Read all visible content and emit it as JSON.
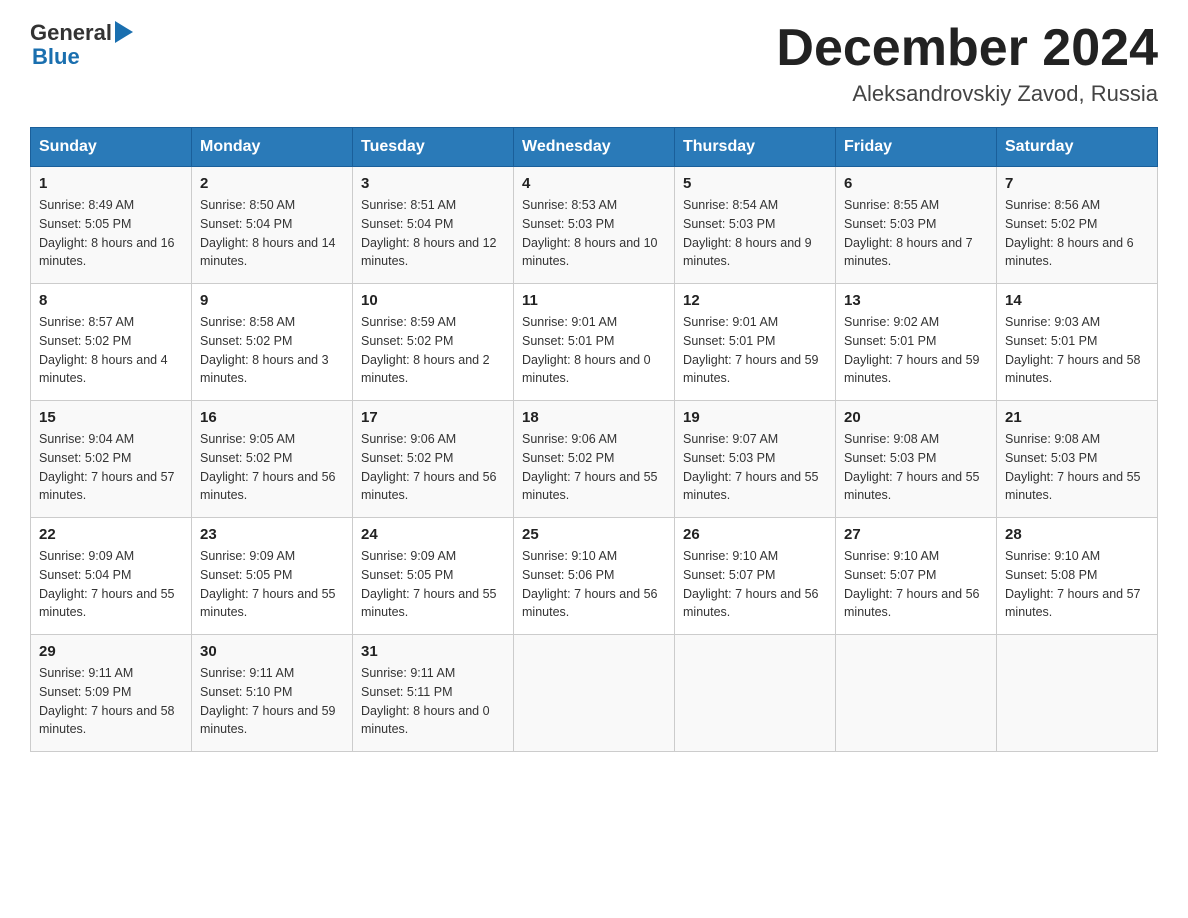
{
  "header": {
    "logo_general": "General",
    "logo_triangle": "▶",
    "logo_blue": "Blue",
    "month_title": "December 2024",
    "location": "Aleksandrovskiy Zavod, Russia"
  },
  "days_of_week": [
    "Sunday",
    "Monday",
    "Tuesday",
    "Wednesday",
    "Thursday",
    "Friday",
    "Saturday"
  ],
  "weeks": [
    [
      {
        "day": "1",
        "sunrise": "8:49 AM",
        "sunset": "5:05 PM",
        "daylight": "8 hours and 16 minutes."
      },
      {
        "day": "2",
        "sunrise": "8:50 AM",
        "sunset": "5:04 PM",
        "daylight": "8 hours and 14 minutes."
      },
      {
        "day": "3",
        "sunrise": "8:51 AM",
        "sunset": "5:04 PM",
        "daylight": "8 hours and 12 minutes."
      },
      {
        "day": "4",
        "sunrise": "8:53 AM",
        "sunset": "5:03 PM",
        "daylight": "8 hours and 10 minutes."
      },
      {
        "day": "5",
        "sunrise": "8:54 AM",
        "sunset": "5:03 PM",
        "daylight": "8 hours and 9 minutes."
      },
      {
        "day": "6",
        "sunrise": "8:55 AM",
        "sunset": "5:03 PM",
        "daylight": "8 hours and 7 minutes."
      },
      {
        "day": "7",
        "sunrise": "8:56 AM",
        "sunset": "5:02 PM",
        "daylight": "8 hours and 6 minutes."
      }
    ],
    [
      {
        "day": "8",
        "sunrise": "8:57 AM",
        "sunset": "5:02 PM",
        "daylight": "8 hours and 4 minutes."
      },
      {
        "day": "9",
        "sunrise": "8:58 AM",
        "sunset": "5:02 PM",
        "daylight": "8 hours and 3 minutes."
      },
      {
        "day": "10",
        "sunrise": "8:59 AM",
        "sunset": "5:02 PM",
        "daylight": "8 hours and 2 minutes."
      },
      {
        "day": "11",
        "sunrise": "9:01 AM",
        "sunset": "5:01 PM",
        "daylight": "8 hours and 0 minutes."
      },
      {
        "day": "12",
        "sunrise": "9:01 AM",
        "sunset": "5:01 PM",
        "daylight": "7 hours and 59 minutes."
      },
      {
        "day": "13",
        "sunrise": "9:02 AM",
        "sunset": "5:01 PM",
        "daylight": "7 hours and 59 minutes."
      },
      {
        "day": "14",
        "sunrise": "9:03 AM",
        "sunset": "5:01 PM",
        "daylight": "7 hours and 58 minutes."
      }
    ],
    [
      {
        "day": "15",
        "sunrise": "9:04 AM",
        "sunset": "5:02 PM",
        "daylight": "7 hours and 57 minutes."
      },
      {
        "day": "16",
        "sunrise": "9:05 AM",
        "sunset": "5:02 PM",
        "daylight": "7 hours and 56 minutes."
      },
      {
        "day": "17",
        "sunrise": "9:06 AM",
        "sunset": "5:02 PM",
        "daylight": "7 hours and 56 minutes."
      },
      {
        "day": "18",
        "sunrise": "9:06 AM",
        "sunset": "5:02 PM",
        "daylight": "7 hours and 55 minutes."
      },
      {
        "day": "19",
        "sunrise": "9:07 AM",
        "sunset": "5:03 PM",
        "daylight": "7 hours and 55 minutes."
      },
      {
        "day": "20",
        "sunrise": "9:08 AM",
        "sunset": "5:03 PM",
        "daylight": "7 hours and 55 minutes."
      },
      {
        "day": "21",
        "sunrise": "9:08 AM",
        "sunset": "5:03 PM",
        "daylight": "7 hours and 55 minutes."
      }
    ],
    [
      {
        "day": "22",
        "sunrise": "9:09 AM",
        "sunset": "5:04 PM",
        "daylight": "7 hours and 55 minutes."
      },
      {
        "day": "23",
        "sunrise": "9:09 AM",
        "sunset": "5:05 PM",
        "daylight": "7 hours and 55 minutes."
      },
      {
        "day": "24",
        "sunrise": "9:09 AM",
        "sunset": "5:05 PM",
        "daylight": "7 hours and 55 minutes."
      },
      {
        "day": "25",
        "sunrise": "9:10 AM",
        "sunset": "5:06 PM",
        "daylight": "7 hours and 56 minutes."
      },
      {
        "day": "26",
        "sunrise": "9:10 AM",
        "sunset": "5:07 PM",
        "daylight": "7 hours and 56 minutes."
      },
      {
        "day": "27",
        "sunrise": "9:10 AM",
        "sunset": "5:07 PM",
        "daylight": "7 hours and 56 minutes."
      },
      {
        "day": "28",
        "sunrise": "9:10 AM",
        "sunset": "5:08 PM",
        "daylight": "7 hours and 57 minutes."
      }
    ],
    [
      {
        "day": "29",
        "sunrise": "9:11 AM",
        "sunset": "5:09 PM",
        "daylight": "7 hours and 58 minutes."
      },
      {
        "day": "30",
        "sunrise": "9:11 AM",
        "sunset": "5:10 PM",
        "daylight": "7 hours and 59 minutes."
      },
      {
        "day": "31",
        "sunrise": "9:11 AM",
        "sunset": "5:11 PM",
        "daylight": "8 hours and 0 minutes."
      },
      null,
      null,
      null,
      null
    ]
  ]
}
